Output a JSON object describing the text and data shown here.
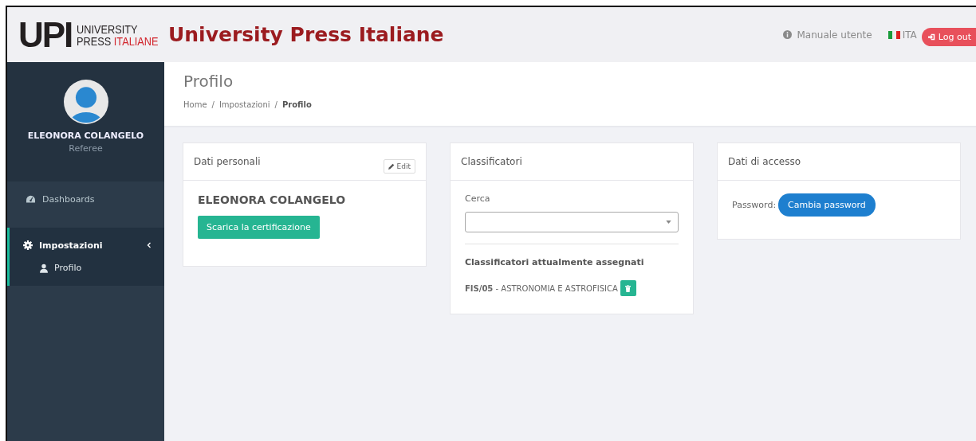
{
  "header": {
    "logo": {
      "mark": "UPI",
      "line_1": "UNIVERSITY",
      "line_2_a": "PRESS",
      "line_2_b": "ITALIANE"
    },
    "title": "University Press Italiane",
    "manual_link": "Manuale utente",
    "language": "ITA",
    "logout_button": "Log out"
  },
  "sidebar": {
    "user": {
      "name": "ELEONORA COLANGELO",
      "role": "Referee"
    },
    "items": [
      {
        "label": "Dashboards",
        "kind": "dashboard",
        "selected": false
      },
      {
        "label": "Impostazioni",
        "kind": "settings",
        "selected": true,
        "expanded": true,
        "children": [
          {
            "label": "Profilo",
            "kind": "user",
            "selected": true
          }
        ]
      }
    ]
  },
  "page": {
    "title": "Profilo",
    "breadcrumb_separator": "/",
    "breadcrumb": [
      {
        "label": "Home",
        "current": false
      },
      {
        "label": "Impostazioni",
        "current": false
      },
      {
        "label": "Profilo",
        "current": true
      }
    ]
  },
  "cards": [
    {
      "kind": "personal",
      "title": "Dati personali",
      "edit_button": "Edit",
      "name": "ELEONORA COLANGELO",
      "download_button": "Scarica la certificazione"
    },
    {
      "kind": "classifiers",
      "title": "Classificatori",
      "search_label": "Cerca",
      "assigned_title": "Classificatori attualmente assegnati",
      "assigned": [
        "**FIS/05** - ASTRONOMIA E ASTROFISICA"
      ]
    },
    {
      "kind": "access",
      "title": "Dati di accesso",
      "password_label": "Password:",
      "change_button": "Cambia password"
    }
  ]
}
